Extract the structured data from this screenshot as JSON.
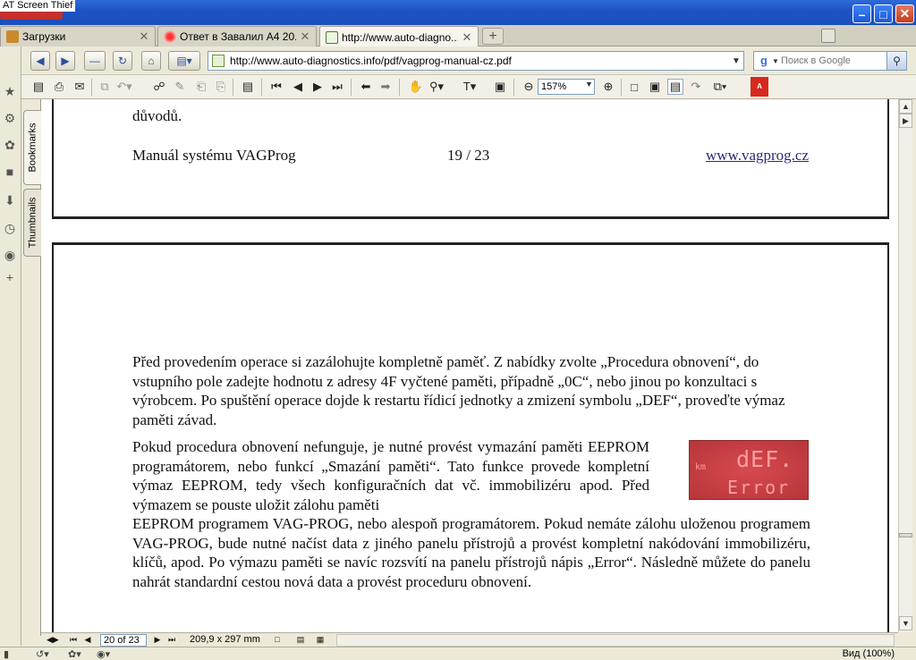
{
  "window": {
    "title": "AT Screen Thief"
  },
  "tabs": [
    {
      "label": "Загрузки",
      "icon": "download-icon"
    },
    {
      "label": "Ответ в Завалил А4 20...",
      "icon": "forum-icon"
    },
    {
      "label": "http://www.auto-diagno...",
      "icon": "pdf-page-icon"
    }
  ],
  "navbar": {
    "url": "http://www.auto-diagnostics.info/pdf/vagprog-manual-cz.pdf",
    "search_placeholder": "Поиск в Google"
  },
  "pdf_toolbar": {
    "zoom": "157%"
  },
  "panel_tabs": {
    "bookmarks": "Bookmarks",
    "thumbnails": "Thumbnails"
  },
  "document": {
    "page1": {
      "prev_word": "důvodů.",
      "footer_left": "Manuál systému VAGProg",
      "footer_mid": "19 / 23",
      "footer_right": "www.vagprog.cz"
    },
    "page2": {
      "para1": "Před provedením operace si zazálohujte kompletně paměť. Z nabídky zvolte „Procedura obnovení“, do vstupního pole zadejte hodnotu z adresy 4F vyčtené paměti, případně „0C“, nebo jinou po konzultaci s výrobcem. Po spuštění operace dojde k restartu řídicí jednotky a zmizení symbolu „DEF“, proveďte výmaz paměti závad.",
      "para2": "Pokud procedura obnovení nefunguje, je nutné provést vymazání paměti EEPROM programátorem, nebo funkcí „Smazání paměti“. Tato funkce provede kompletní výmaz EEPROM, tedy všech konfiguračních dat vč. immobilizéru apod. Před výmazem se pouste uložit zálohu paměti",
      "para3": "EEPROM programem VAG-PROG, nebo alespoň programátorem. Pokud nemáte zálohu uloženou programem VAG-PROG, bude nutné načíst data z jiného panelu přístrojů a provést kompletní nakódování immobilizéru, klíčů, apod. Po výmazu paměti se navíc rozsvítí na panelu přístrojů nápis „Error“. Následně můžete do panelu nahrát standardní cestou nová data a provést proceduru obnovení.",
      "lcd": {
        "unit": "km",
        "line1": "dEF.",
        "line2": "Error"
      }
    }
  },
  "pdf_status": {
    "page": "20 of 23",
    "page_size": "209,9 x 297 mm"
  },
  "statusbar": {
    "zoom": "Вид (100%)"
  }
}
